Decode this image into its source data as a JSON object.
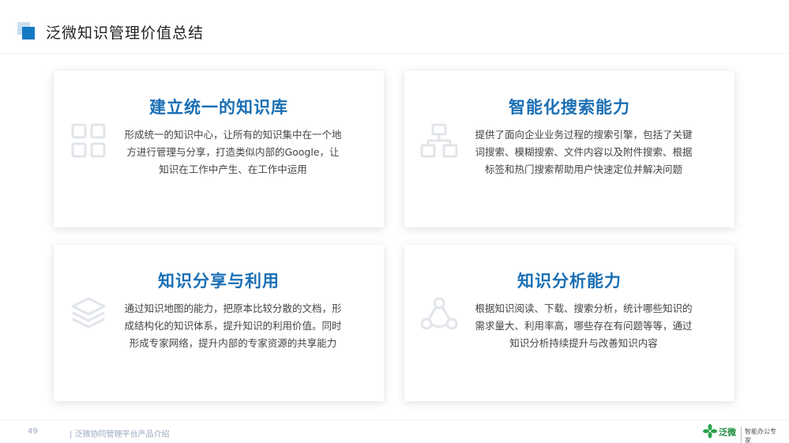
{
  "header": {
    "title": "泛微知识管理价值总结"
  },
  "cards": [
    {
      "title": "建立统一的知识库",
      "lines": [
        "形成统一的知识中心，让所有的知识集中在一个地",
        "方进行管理与分享，打造类似内部的Google，让",
        "知识在工作中产生、在工作中运用"
      ],
      "icon": "grid-icon"
    },
    {
      "title": "智能化搜索能力",
      "lines": [
        "提供了面向企业业务过程的搜索引擎，包括了关键",
        "词搜索、模糊搜索、文件内容以及附件搜索、根据",
        "标签和热门搜索帮助用户快速定位并解决问题"
      ],
      "icon": "hierarchy-icon"
    },
    {
      "title": "知识分享与利用",
      "lines": [
        "通过知识地图的能力，把原本比较分散的文档，形",
        "成结构化的知识体系，提升知识的利用价值。同时",
        "形成专家网络，提升内部的专家资源的共享能力"
      ],
      "icon": "layers-icon"
    },
    {
      "title": "知识分析能力",
      "lines": [
        "根据知识阅读、下载、搜索分析，统计哪些知识的",
        "需求量大、利用率高，哪些存在有问题等等，通过",
        "知识分析持续提升与改善知识内容"
      ],
      "icon": "network-icon"
    }
  ],
  "footer": {
    "page": "49",
    "text": "|  泛微协同管理平台产品介绍",
    "logo_name": "泛微",
    "logo_slogan": "智能办公专家"
  },
  "colors": {
    "accent": "#1479c4",
    "title": "#1a6fb4",
    "icon": "#e3e7ec"
  }
}
